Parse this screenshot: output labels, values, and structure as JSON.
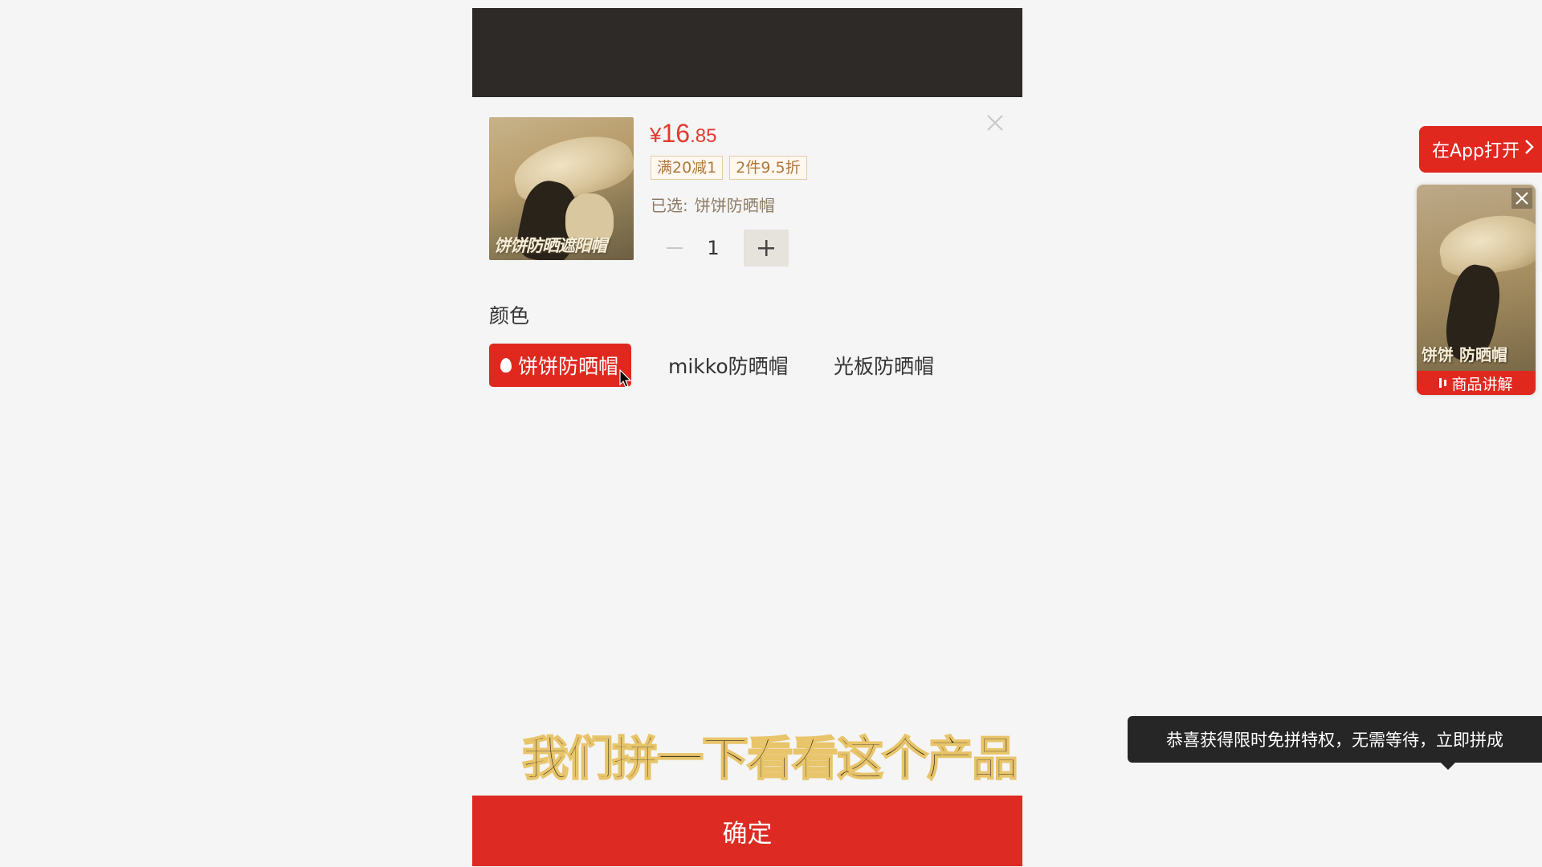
{
  "product": {
    "thumb_caption": "饼饼防晒遮阳帽",
    "price_symbol": "¥",
    "price_integer": "16",
    "price_decimal": ".85",
    "promos": [
      "满20减1",
      "2件9.5折"
    ],
    "selected_label": "已选:",
    "selected_value": "饼饼防晒帽",
    "quantity": "1"
  },
  "spec": {
    "title": "颜色",
    "options": [
      "饼饼防晒帽",
      "mikko防晒帽",
      "光板防晒帽"
    ],
    "selected_index": 0
  },
  "floating": {
    "open_app_label": "在App打开",
    "card_caption": "饼饼 防晒帽",
    "card_bar_label": "商品讲解"
  },
  "subtitle": "我们拼一下看看这个产品",
  "tooltip": "恭喜获得限时免拼特权，无需等待，立即拼成",
  "confirm_label": "确定",
  "colors": {
    "accent": "#e0281f",
    "price": "#e23a2e",
    "banner": "#2e2a28",
    "background": "#f5f5f5"
  },
  "icons": [
    "close-icon",
    "minus-icon",
    "plus-icon",
    "flame-icon",
    "cursor-icon",
    "chevron-right-icon",
    "play-bars-icon"
  ]
}
